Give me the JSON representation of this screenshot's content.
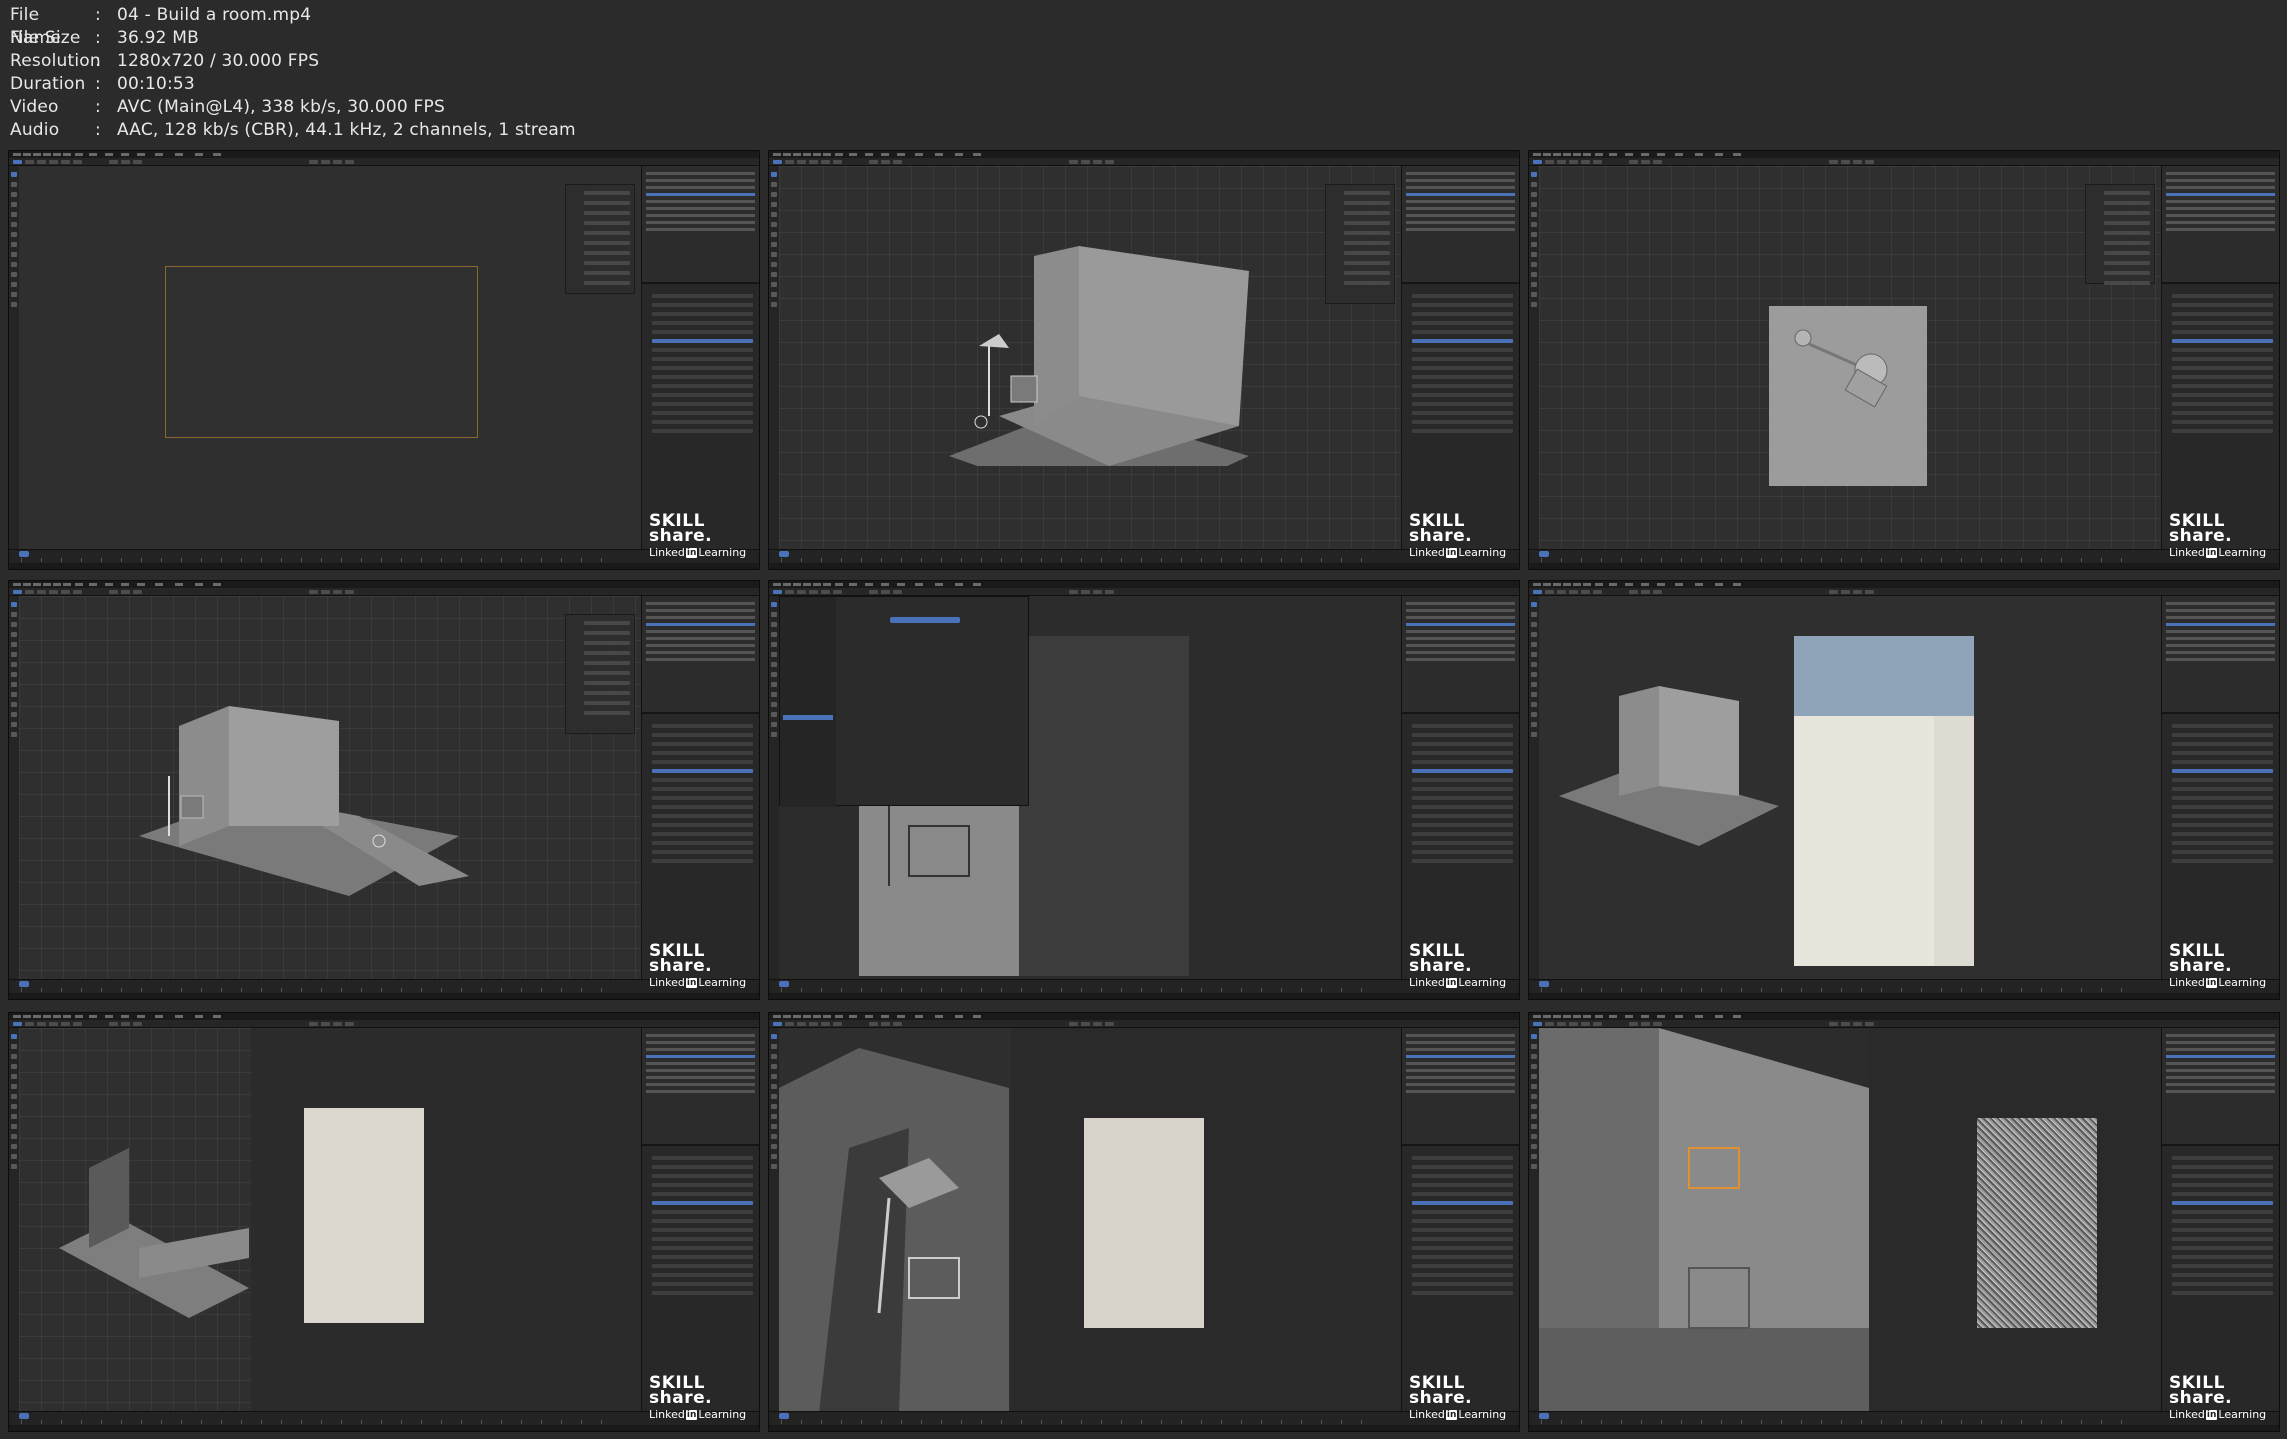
{
  "metadata": [
    {
      "key": "File Name",
      "sep": ":",
      "value": "04 - Build a room.mp4"
    },
    {
      "key": "File Size",
      "sep": ":",
      "value": "36.92 MB"
    },
    {
      "key": "Resolution",
      "sep": ":",
      "value": "1280x720 / 30.000 FPS"
    },
    {
      "key": "Duration",
      "sep": ":",
      "value": "00:10:53"
    },
    {
      "key": "Video",
      "sep": ":",
      "value": "AVC (Main@L4), 338 kb/s, 30.000 FPS"
    },
    {
      "key": "Audio",
      "sep": ":",
      "value": "AAC, 128 kb/s (CBR), 44.1 kHz, 2 channels, 1 stream"
    }
  ],
  "watermark": {
    "skill": "SKILL",
    "share": "share.",
    "linked": "Linked",
    "in": "in",
    "learning": "Learning"
  },
  "colors": {
    "background": "#2b2b2b",
    "accent": "#4a72b8",
    "text": "#e8e8e8"
  },
  "thumbnails": [
    {
      "index": 1,
      "scene": "camera-view-empty"
    },
    {
      "index": 2,
      "scene": "room-corner-lamp-chair"
    },
    {
      "index": 3,
      "scene": "top-orthographic-plane"
    },
    {
      "index": 4,
      "scene": "room-walls-edit"
    },
    {
      "index": 5,
      "scene": "preferences-dialog"
    },
    {
      "index": 6,
      "scene": "rendered-room"
    },
    {
      "index": 7,
      "scene": "walls-and-render-preview"
    },
    {
      "index": 8,
      "scene": "close-up-lamp-render"
    },
    {
      "index": 9,
      "scene": "noisy-render-preview"
    }
  ]
}
